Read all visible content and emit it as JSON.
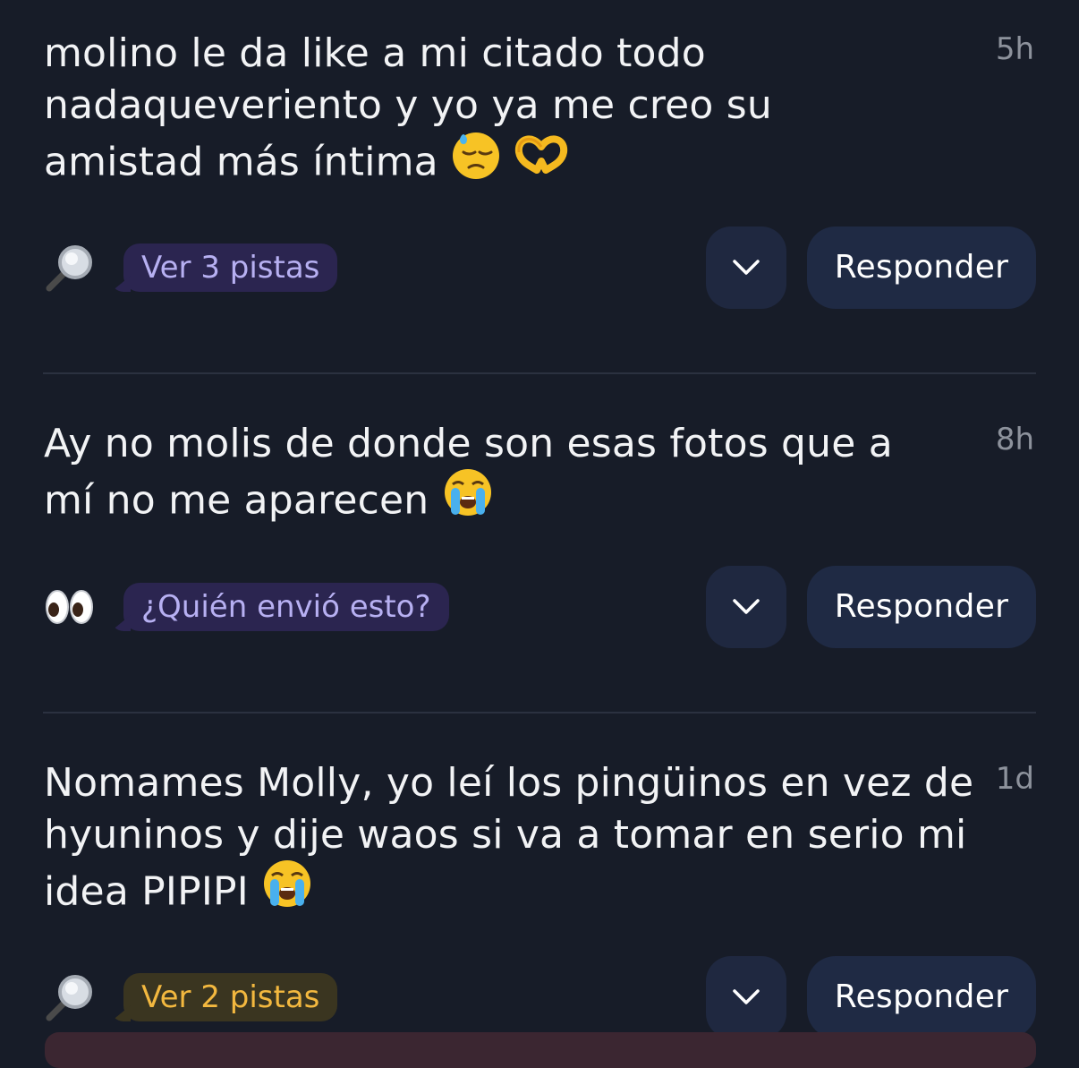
{
  "messages": [
    {
      "text": "molino le da like a mi citado todo nadaqueveriento y yo ya me creo su amistad más íntima",
      "time": "5h",
      "emojis": [
        "downcast-sweat-emoji",
        "heart-hands-emoji"
      ],
      "hint_icon": "magnifying-glass-icon",
      "hint_label": "Ver 3 pistas",
      "hint_style": "purple",
      "reply_label": "Responder"
    },
    {
      "text": "Ay no molis de donde son esas fotos que a mí no me aparecen",
      "time": "8h",
      "emojis": [
        "loudly-crying-emoji"
      ],
      "hint_icon": "eyes-icon",
      "hint_label": "¿Quién envió esto?",
      "hint_style": "purple",
      "reply_label": "Responder"
    },
    {
      "text": "Nomames Molly, yo leí los pingüinos en vez de hyuninos y dije waos si va a tomar en serio mi idea PIPIPI",
      "time": "1d",
      "emojis": [
        "loudly-crying-emoji"
      ],
      "hint_icon": "magnifying-glass-icon",
      "hint_label": "Ver 2 pistas",
      "hint_style": "orange",
      "reply_label": "Responder"
    }
  ],
  "colors": {
    "background": "#171c28",
    "button": "#1f2a44",
    "pill_purple_bg": "#2b2550",
    "pill_purple_text": "#b7b0f2",
    "pill_orange_bg": "#3a3520",
    "pill_orange_text": "#f3b83f"
  }
}
